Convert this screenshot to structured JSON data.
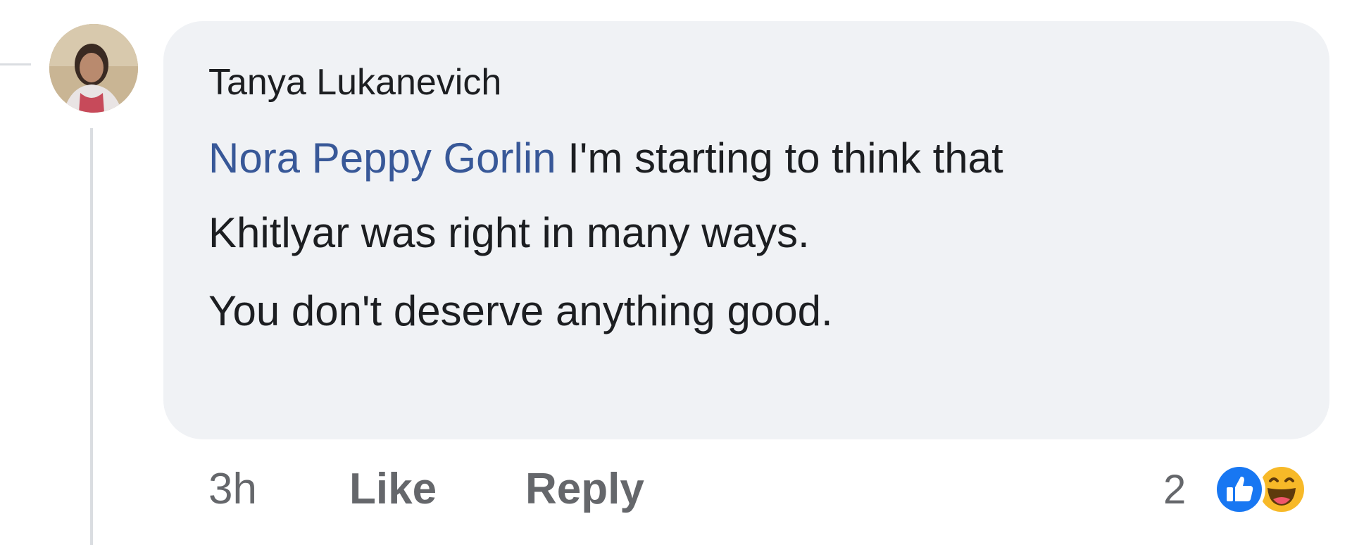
{
  "comment": {
    "author": "Tanya Lukanevich",
    "mention": "Nora Peppy Gorlin",
    "text_line1_rest": " I'm starting to think that",
    "text_line2": "Khitlyar was right in many ways.",
    "text_line3": "You don't deserve anything good."
  },
  "actions": {
    "time": "3h",
    "like_label": "Like",
    "reply_label": "Reply"
  },
  "reactions": {
    "count": "2",
    "icons": [
      "like-reaction-icon",
      "haha-reaction-icon"
    ]
  },
  "colors": {
    "bubble": "#f0f2f5",
    "mention": "#385898",
    "meta_text": "#65676b",
    "like_blue": "#1877f2",
    "haha_yellow": "#f7b928"
  }
}
